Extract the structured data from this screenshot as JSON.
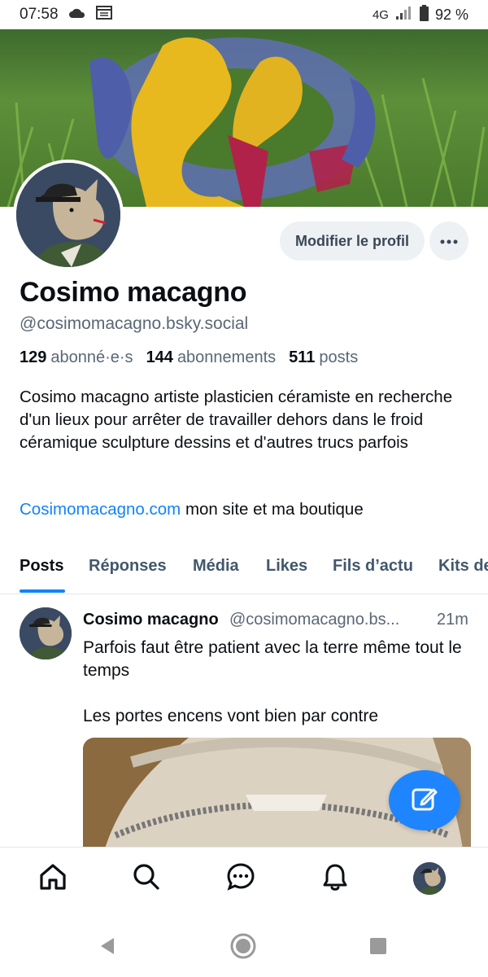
{
  "status_bar": {
    "time": "07:58",
    "network": "4G",
    "battery": "92 %"
  },
  "profile": {
    "display_name": "Cosimo macagno",
    "handle": "@cosimomacagno.bsky.social",
    "followers_count": "129",
    "followers_label": "abonné·e·s",
    "following_count": "144",
    "following_label": "abonnements",
    "posts_count": "511",
    "posts_label": "posts",
    "bio": "Cosimo macagno artiste plasticien céramiste en recherche d'un lieux pour arrêter de travailler dehors dans le froid céramique sculpture dessins et d'autres trucs parfois",
    "link_text": "Cosimomacagno.com",
    "link_suffix": " mon site et ma boutique"
  },
  "actions": {
    "edit_profile_label": "Modifier le profil",
    "more_icon": "ellipsis-icon"
  },
  "tabs": [
    {
      "label": "Posts",
      "active": true
    },
    {
      "label": "Réponses",
      "active": false
    },
    {
      "label": "Média",
      "active": false
    },
    {
      "label": "Likes",
      "active": false
    },
    {
      "label": "Fils d’actu",
      "active": false
    },
    {
      "label": "Kits de",
      "active": false
    }
  ],
  "post": {
    "author": "Cosimo macagno",
    "handle": "@cosimomacagno.bs...",
    "time": "21m",
    "text_line1": "Parfois faut être patient avec la terre même tout le temps",
    "text_line2": "Les portes encens vont bien par contre"
  },
  "bottom_nav": [
    "home-icon",
    "search-icon",
    "chat-icon",
    "bell-icon",
    "profile-avatar"
  ],
  "colors": {
    "accent": "#1083fe",
    "fab": "#1f85ff",
    "muted_text": "#5a6775",
    "button_bg": "#eef1f4"
  }
}
